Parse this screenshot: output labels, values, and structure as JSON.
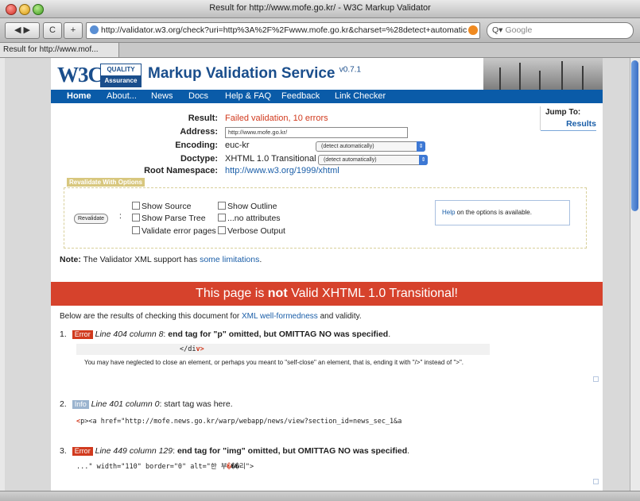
{
  "window": {
    "title": "Result for http://www.mofe.go.kr/ - W3C Markup Validator"
  },
  "toolbar": {
    "back_fwd": "◀ ▶",
    "reload": "C",
    "add": "+",
    "url": "http://validator.w3.org/check?uri=http%3A%2F%2Fwww.mofe.go.kr&charset=%28detect+automatic",
    "search_placeholder": "Google"
  },
  "tab": {
    "label": "Result for http://www.mof..."
  },
  "header": {
    "logo_w3c": "W3C",
    "qa_top": "QUALITY",
    "qa_bottom": "Assurance",
    "service_title": "Markup Validation Service",
    "version": "v0.7.1"
  },
  "nav": {
    "items": [
      "Home",
      "About...",
      "News",
      "Docs",
      "Help & FAQ",
      "Feedback",
      "Link Checker"
    ]
  },
  "jump": {
    "title": "Jump To:",
    "link": "Results"
  },
  "results": {
    "result_label": "Result:",
    "result_value": "Failed validation, 10 errors",
    "address_label": "Address:",
    "address_value": "http://www.mofe.go.kr/",
    "encoding_label": "Encoding:",
    "encoding_value": "euc-kr",
    "encoding_select": "(detect automatically)",
    "doctype_label": "Doctype:",
    "doctype_value": "XHTML 1.0 Transitional",
    "doctype_select": "(detect automatically)",
    "rootns_label": "Root Namespace:",
    "rootns_value": "http://www.w3.org/1999/xhtml"
  },
  "revalidate": {
    "title": "Revalidate With Options",
    "button": "Revalidate",
    "options": {
      "show_source": "Show Source",
      "show_outline": "Show Outline",
      "show_parse_tree": "Show Parse Tree",
      "no_attributes": "...no attributes",
      "validate_error_pages": "Validate error pages",
      "verbose_output": "Verbose Output"
    },
    "help_link": "Help",
    "help_text": " on the options is available."
  },
  "note": {
    "label": "Note:",
    "text": " The Validator XML support has ",
    "link": "some limitations",
    "end": "."
  },
  "banner": {
    "pre": "This page is ",
    "bold": "not",
    "post": " Valid XHTML 1.0 Transitional!"
  },
  "intro": {
    "pre": "Below are the results of checking this document for ",
    "link": "XML well-formedness",
    "post": " and validity."
  },
  "messages": [
    {
      "num": "1.",
      "type": "Error",
      "location": "Line 404 column 8",
      "text": "end tag for \"p\" omitted, but OMITTAG NO was specified",
      "code_pre": "</di",
      "code_hl": "v>",
      "desc": "You may have neglected to close an element, or perhaps you meant to \"self-close\" an element, that is, ending it with \"/>\" instead of \">\"."
    },
    {
      "num": "2.",
      "type": "Info",
      "location": "Line 401 column 0",
      "text": "start tag was here.",
      "code_hl": "<",
      "code_post": "p><a href=\"http://mofe.news.go.kr/warp/webapp/news/view?section_id=news_sec_1&a"
    },
    {
      "num": "3.",
      "type": "Error",
      "location": "Line 449 column 129",
      "text": "end tag for \"img\" omitted, but OMITTAG NO was specified",
      "code_pre": "...\" width=\"110\" border=\"0\" alt=\"한 부",
      "code_hl": "�",
      "code_post": "��리\">"
    }
  ],
  "colors": {
    "error": "#d13a1e",
    "link": "#1a5ea8",
    "nav": "#0a5ba8"
  }
}
